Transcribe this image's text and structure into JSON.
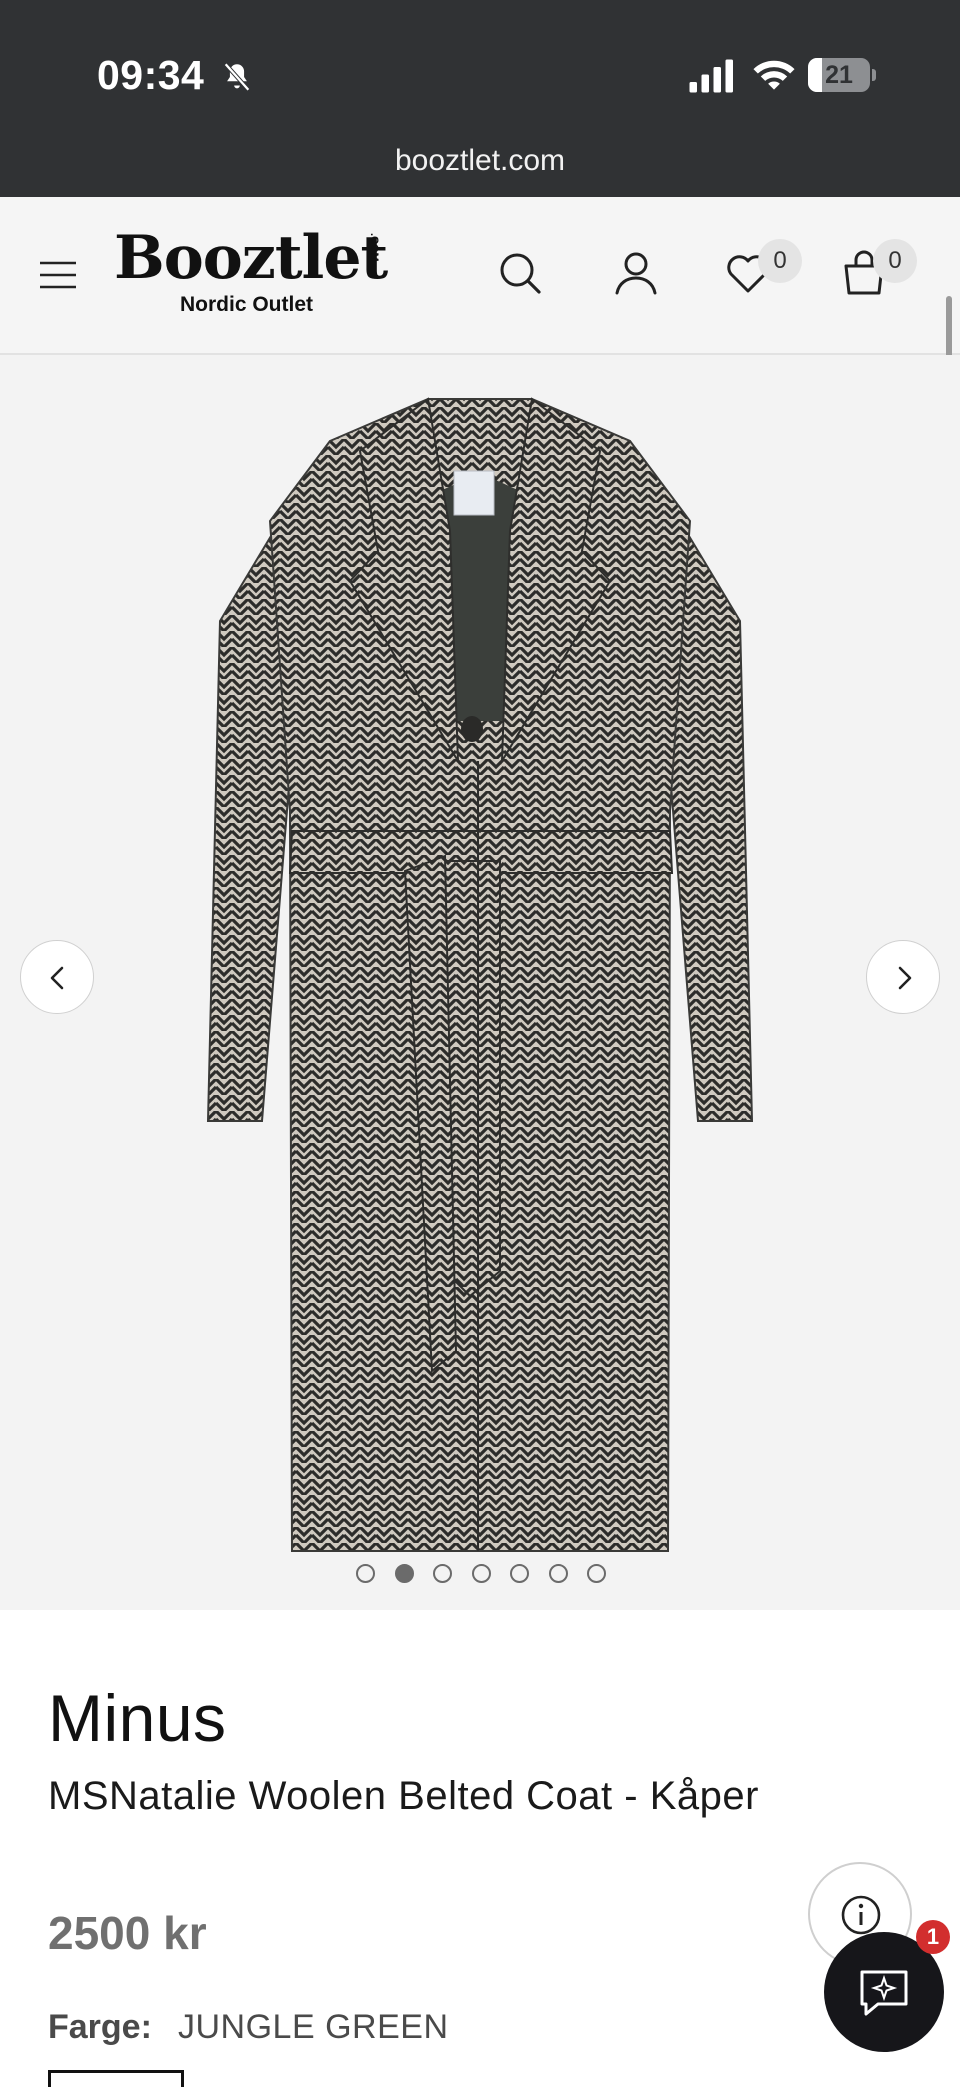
{
  "status_bar": {
    "time": "09:34",
    "battery_level": "21",
    "icons": [
      "bell-off-icon",
      "signal-icon",
      "wifi-icon",
      "battery-icon"
    ]
  },
  "browser": {
    "url": "booztlet.com"
  },
  "header": {
    "logo_text": "Booztlet",
    "logo_suffix": ".COM",
    "logo_subtitle": "Nordic Outlet",
    "wishlist_count": "0",
    "cart_count": "0",
    "icons": [
      "menu-icon",
      "search-icon",
      "user-icon",
      "heart-icon",
      "bag-icon"
    ]
  },
  "gallery": {
    "image_alt": "Herringbone belted coat",
    "total_images": 7,
    "active_index": 1
  },
  "product": {
    "brand": "Minus",
    "name": "MSNatalie Woolen Belted Coat - Kåper",
    "price": "2500 kr",
    "color_label": "Farge:",
    "color_value": "JUNGLE GREEN"
  },
  "floating": {
    "chat_badge_count": "1",
    "icons": [
      "info-icon",
      "chat-icon"
    ]
  },
  "colors": {
    "browser_bar": "#303234",
    "header_bg": "#f5f5f5",
    "gallery_bg": "#f3f3f3",
    "badge_red": "#d22e2e",
    "chat_bg": "#16161a"
  }
}
